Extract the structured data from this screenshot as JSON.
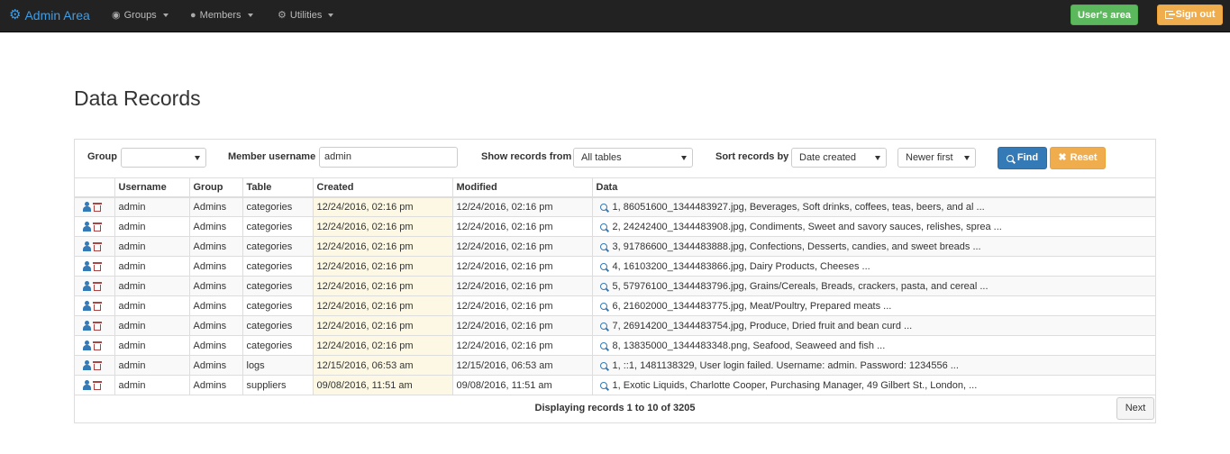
{
  "nav": {
    "brand": "Admin Area",
    "menus": [
      {
        "label": "Groups",
        "icon": "globe-icon"
      },
      {
        "label": "Members",
        "icon": "user-icon"
      },
      {
        "label": "Utilities",
        "icon": "cog-icon"
      }
    ],
    "users_area": "User's area",
    "sign_out": "Sign out"
  },
  "page": {
    "title": "Data Records"
  },
  "filters": {
    "group_label": "Group",
    "group_value": "",
    "member_label": "Member username",
    "member_value": "admin",
    "show_label": "Show records from",
    "show_value": "All tables",
    "sort_label": "Sort records by",
    "sort_value": "Date created",
    "order_value": "Newer first",
    "find_label": "Find",
    "reset_label": "Reset"
  },
  "table": {
    "headers": [
      "",
      "Username",
      "Group",
      "Table",
      "Created",
      "Modified",
      "Data"
    ],
    "rows": [
      [
        "admin",
        "Admins",
        "categories",
        "12/24/2016, 02:16 pm",
        "12/24/2016, 02:16 pm",
        "1, 86051600_1344483927.jpg, Beverages, Soft drinks, coffees, teas, beers, and al ..."
      ],
      [
        "admin",
        "Admins",
        "categories",
        "12/24/2016, 02:16 pm",
        "12/24/2016, 02:16 pm",
        "2, 24242400_1344483908.jpg, Condiments, Sweet and savory sauces, relishes, sprea ..."
      ],
      [
        "admin",
        "Admins",
        "categories",
        "12/24/2016, 02:16 pm",
        "12/24/2016, 02:16 pm",
        "3, 91786600_1344483888.jpg, Confections, Desserts, candies, and sweet breads ..."
      ],
      [
        "admin",
        "Admins",
        "categories",
        "12/24/2016, 02:16 pm",
        "12/24/2016, 02:16 pm",
        "4, 16103200_1344483866.jpg, Dairy Products, Cheeses ..."
      ],
      [
        "admin",
        "Admins",
        "categories",
        "12/24/2016, 02:16 pm",
        "12/24/2016, 02:16 pm",
        "5, 57976100_1344483796.jpg, Grains/Cereals, Breads, crackers, pasta, and cereal ..."
      ],
      [
        "admin",
        "Admins",
        "categories",
        "12/24/2016, 02:16 pm",
        "12/24/2016, 02:16 pm",
        "6, 21602000_1344483775.jpg, Meat/Poultry, Prepared meats ..."
      ],
      [
        "admin",
        "Admins",
        "categories",
        "12/24/2016, 02:16 pm",
        "12/24/2016, 02:16 pm",
        "7, 26914200_1344483754.jpg, Produce, Dried fruit and bean curd ..."
      ],
      [
        "admin",
        "Admins",
        "categories",
        "12/24/2016, 02:16 pm",
        "12/24/2016, 02:16 pm",
        "8, 13835000_1344483348.png, Seafood, Seaweed and fish ..."
      ],
      [
        "admin",
        "Admins",
        "logs",
        "12/15/2016, 06:53 am",
        "12/15/2016, 06:53 am",
        "1, ::1, 1481138329, User login failed. Username: admin. Password: 1234556 ..."
      ],
      [
        "admin",
        "Admins",
        "suppliers",
        "09/08/2016, 11:51 am",
        "09/08/2016, 11:51 am",
        "1, Exotic Liquids, Charlotte Cooper, Purchasing Manager, 49 Gilbert St., London, ..."
      ]
    ]
  },
  "pager": {
    "text": "Displaying records 1 to 10 of 3205",
    "next_label": "Next"
  }
}
